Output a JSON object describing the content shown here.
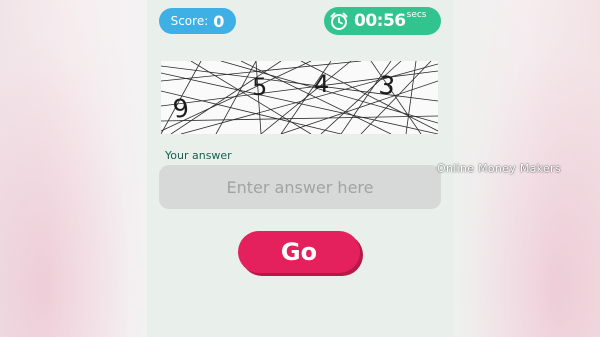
{
  "header": {
    "score_label": "Score:",
    "score_value": "0",
    "timer_value": "00:56",
    "timer_unit": "secs",
    "timer_icon": "alarm-clock-icon"
  },
  "captcha": {
    "digits": [
      "9",
      "5",
      "4",
      "3"
    ]
  },
  "form": {
    "answer_label": "Your answer",
    "answer_placeholder": "Enter answer here",
    "answer_value": "",
    "go_label": "Go"
  },
  "overlay": {
    "watermark": "Online Money Makers"
  },
  "colors": {
    "score_pill": "#3eb0e6",
    "timer_pill": "#31c48f",
    "go_button": "#e4215c",
    "label_text": "#1d5e50",
    "input_bg": "#d6d9d8"
  }
}
